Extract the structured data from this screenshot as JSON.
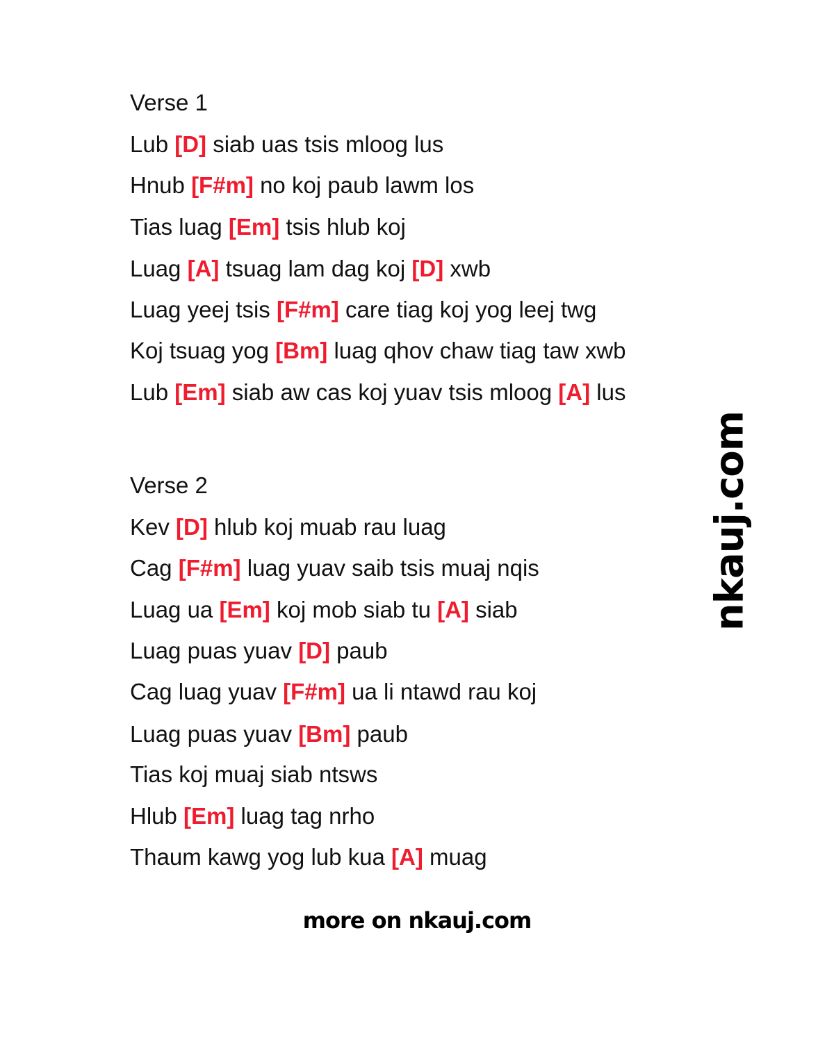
{
  "colors": {
    "text": "#111111",
    "chord": "#ee1c2e",
    "background": "#ffffff"
  },
  "verses": [
    {
      "title": "Verse 1",
      "lines": [
        [
          {
            "t": "Lub "
          },
          {
            "c": "[D]"
          },
          {
            "t": " siab uas tsis mloog lus"
          }
        ],
        [
          {
            "t": "Hnub "
          },
          {
            "c": "[F#m]"
          },
          {
            "t": " no koj paub lawm los"
          }
        ],
        [
          {
            "t": "Tias luag "
          },
          {
            "c": "[Em]"
          },
          {
            "t": " tsis hlub koj"
          }
        ],
        [
          {
            "t": "Luag "
          },
          {
            "c": "[A]"
          },
          {
            "t": " tsuag lam dag koj "
          },
          {
            "c": "[D]"
          },
          {
            "t": " xwb"
          }
        ],
        [
          {
            "t": "Luag yeej tsis "
          },
          {
            "c": "[F#m]"
          },
          {
            "t": " care tiag koj yog leej twg"
          }
        ],
        [
          {
            "t": "Koj tsuag yog "
          },
          {
            "c": "[Bm]"
          },
          {
            "t": " luag qhov chaw tiag taw xwb"
          }
        ],
        [
          {
            "t": "Lub "
          },
          {
            "c": "[Em]"
          },
          {
            "t": " siab aw cas koj yuav tsis mloog "
          },
          {
            "c": "[A]"
          },
          {
            "t": " lus"
          }
        ]
      ]
    },
    {
      "title": "Verse 2",
      "lines": [
        [
          {
            "t": "Kev "
          },
          {
            "c": "[D]"
          },
          {
            "t": " hlub koj muab rau luag"
          }
        ],
        [
          {
            "t": "Cag "
          },
          {
            "c": "[F#m]"
          },
          {
            "t": " luag yuav saib tsis muaj nqis"
          }
        ],
        [
          {
            "t": "Luag ua "
          },
          {
            "c": "[Em]"
          },
          {
            "t": " koj mob siab tu "
          },
          {
            "c": "[A]"
          },
          {
            "t": " siab"
          }
        ],
        [
          {
            "t": "Luag puas yuav "
          },
          {
            "c": "[D]"
          },
          {
            "t": " paub"
          }
        ],
        [
          {
            "t": "Cag luag yuav "
          },
          {
            "c": "[F#m]"
          },
          {
            "t": " ua li ntawd rau koj"
          }
        ],
        [
          {
            "t": "Luag puas yuav "
          },
          {
            "c": "[Bm]"
          },
          {
            "t": " paub"
          }
        ],
        [
          {
            "t": "Tias koj muaj siab ntsws"
          }
        ],
        [
          {
            "t": "Hlub "
          },
          {
            "c": "[Em]"
          },
          {
            "t": " luag tag nrho"
          }
        ],
        [
          {
            "t": "Thaum kawg yog lub kua "
          },
          {
            "c": "[A]"
          },
          {
            "t": " muag"
          }
        ]
      ]
    }
  ],
  "watermark": "nkauj.com",
  "footer": "more on nkauj.com"
}
